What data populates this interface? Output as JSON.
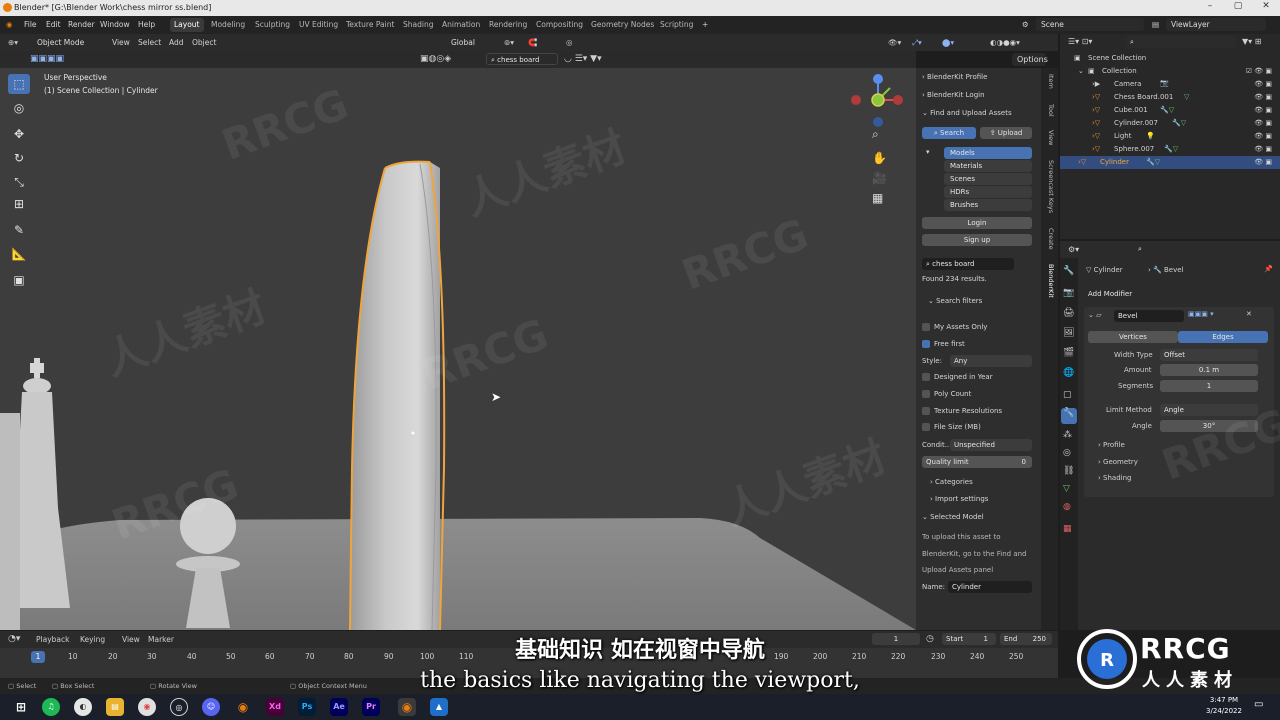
{
  "window": {
    "title": "Blender* [G:\\Blender Work\\chess mirror ss.blend]"
  },
  "menu": {
    "items": [
      "File",
      "Edit",
      "Render",
      "Window",
      "Help"
    ],
    "workspaces": [
      "Layout",
      "Modeling",
      "Sculpting",
      "UV Editing",
      "Texture Paint",
      "Shading",
      "Animation",
      "Rendering",
      "Compositing",
      "Geometry Nodes",
      "Scripting"
    ],
    "active_workspace": "Layout",
    "scene_label": "Scene",
    "viewlayer_label": "ViewLayer"
  },
  "viewport_header": {
    "mode": "Object Mode",
    "menus": [
      "View",
      "Select",
      "Add",
      "Object"
    ],
    "orientation": "Global",
    "search_value": "chess board",
    "options_label": "Options"
  },
  "viewport": {
    "perspective": "User Perspective",
    "collection_info": "(1) Scene Collection | Cylinder"
  },
  "blenderkit": {
    "profile": "BlenderKit Profile",
    "login_header": "BlenderKit Login",
    "find_upload": "Find and Upload Assets",
    "search_tab": "Search",
    "upload_tab": "Upload",
    "asset_types": [
      "Models",
      "Materials",
      "Scenes",
      "HDRs",
      "Brushes"
    ],
    "login_btn": "Login",
    "signup_btn": "Sign up",
    "search_query": "chess board",
    "found_text": "Found 234 results.",
    "search_filters": "Search filters",
    "my_assets_only": "My Assets Only",
    "free_first": "Free first",
    "style_label": "Style:",
    "style_value": "Any",
    "designed_in_year": "Designed in Year",
    "poly_count": "Poly Count",
    "texture_resolutions": "Texture Resolutions",
    "file_size": "File Size (MB)",
    "condition_label": "Condit...",
    "condition_value": "Unspecified",
    "quality_label": "Quality limit",
    "quality_value": "0",
    "categories": "Categories",
    "import_settings": "Import settings",
    "selected_model": "Selected Model",
    "upload_hint_1": "To upload this asset to",
    "upload_hint_2": "BlenderKit, go to the Find and",
    "upload_hint_3": "Upload Assets panel",
    "name_label": "Name:",
    "name_value": "Cylinder"
  },
  "side_tabs": [
    "Item",
    "Tool",
    "View",
    "Screencast Keys",
    "Create",
    "BlenderKit"
  ],
  "outliner": {
    "root": "Scene Collection",
    "rows": [
      {
        "label": "Collection",
        "selected": false
      },
      {
        "label": "Camera",
        "selected": false
      },
      {
        "label": "Chess Board.001",
        "selected": false
      },
      {
        "label": "Cube.001",
        "selected": false
      },
      {
        "label": "Cylinder.007",
        "selected": false
      },
      {
        "label": "Light",
        "selected": false
      },
      {
        "label": "Sphere.007",
        "selected": false
      },
      {
        "label": "Cylinder",
        "selected": true
      }
    ]
  },
  "properties": {
    "object": "Cylinder",
    "modifier_ref": "Bevel",
    "add_modifier": "Add Modifier",
    "modifier_name": "Bevel",
    "vertices_tab": "Vertices",
    "edges_tab": "Edges",
    "width_type_label": "Width Type",
    "width_type_value": "Offset",
    "amount_label": "Amount",
    "amount_value": "0.1 m",
    "segments_label": "Segments",
    "segments_value": "1",
    "limit_method_label": "Limit Method",
    "limit_method_value": "Angle",
    "angle_label": "Angle",
    "angle_value": "30°",
    "sections": [
      "Profile",
      "Geometry",
      "Shading"
    ]
  },
  "timeline": {
    "menus": [
      "Playback",
      "Keying",
      "View",
      "Marker"
    ],
    "current_frame": "1",
    "start_label": "Start",
    "start_value": "1",
    "end_label": "End",
    "end_value": "250",
    "ticks": [
      "1",
      "10",
      "20",
      "30",
      "40",
      "50",
      "60",
      "70",
      "80",
      "90",
      "100",
      "110",
      "190",
      "200",
      "210",
      "220",
      "230",
      "240",
      "250"
    ]
  },
  "status": {
    "select": "Select",
    "box_select": "Box Select",
    "rotate_view": "Rotate View",
    "context_menu": "Object Context Menu"
  },
  "taskbar": {
    "time": "3:47 PM",
    "date": "3/24/2022"
  },
  "subtitles": {
    "chinese": "基础知识 如在视窗中导航",
    "english": "the basics like navigating the viewport,"
  },
  "watermark": {
    "brand": "RRCG",
    "brand_cn": "人人素材"
  },
  "colors": {
    "accent": "#4772b3",
    "selection_outline": "#f0a53c",
    "blender_orange": "#e87d0d"
  }
}
